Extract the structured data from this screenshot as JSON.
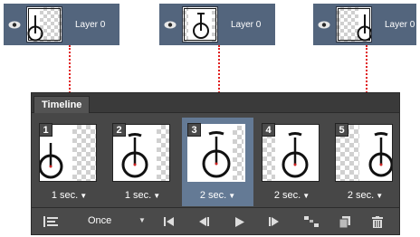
{
  "layers": [
    {
      "name": "Layer 0",
      "frame_ref": 1
    },
    {
      "name": "Layer 0",
      "frame_ref": 3
    },
    {
      "name": "Layer 0",
      "frame_ref": 5
    }
  ],
  "timeline": {
    "tab_label": "Timeline",
    "selected_frame": 3,
    "frames": [
      {
        "number": "1",
        "delay": "1 sec."
      },
      {
        "number": "2",
        "delay": "1 sec."
      },
      {
        "number": "3",
        "delay": "2 sec."
      },
      {
        "number": "4",
        "delay": "2 sec."
      },
      {
        "number": "5",
        "delay": "2 sec."
      }
    ],
    "loop_option": "Once",
    "icons": [
      "convert-icon",
      "first-frame-icon",
      "previous-frame-icon",
      "play-icon",
      "next-frame-icon",
      "tween-icon",
      "duplicate-frame-icon",
      "delete-frame-icon"
    ]
  },
  "colors": {
    "layer_bg": "#53657d",
    "panel_bg": "#474747",
    "selected_frame": "#647a95",
    "connector": "#e02020"
  }
}
